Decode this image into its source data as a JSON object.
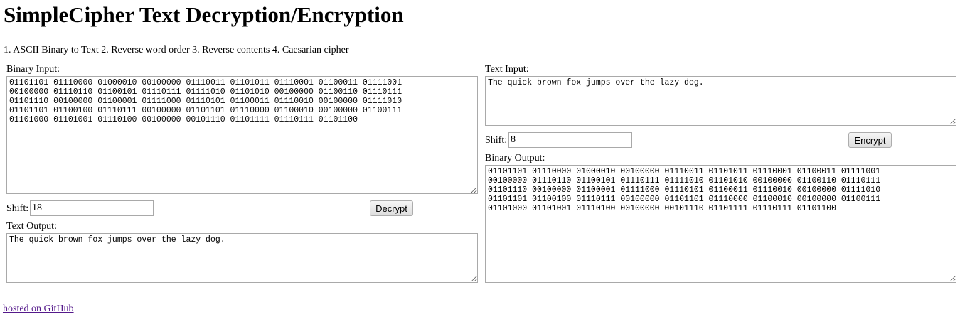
{
  "page": {
    "title": "SimpleCipher Text Decryption/Encryption",
    "steps": "1. ASCII Binary to Text 2. Reverse word order 3. Reverse contents 4. Caesarian cipher",
    "footer_link": "hosted on GitHub"
  },
  "decrypt": {
    "binary_input_label": "Binary Input:",
    "binary_input_value": "01101101 01110000 01000010 00100000 01110011 01101011 01110001 01100011 01111001\n00100000 01110110 01100101 01110111 01111010 01101010 00100000 01100110 01110111\n01101110 00100000 01100001 01111000 01110101 01100011 01110010 00100000 01111010\n01101101 01100100 01110111 00100000 01101101 01110000 01100010 00100000 01100111\n01101000 01101001 01110100 00100000 00101110 01101111 01110111 01101100",
    "shift_label": "Shift:",
    "shift_value": "18",
    "button_label": "Decrypt",
    "text_output_label": "Text Output:",
    "text_output_value": "The quick brown fox jumps over the lazy dog."
  },
  "encrypt": {
    "text_input_label": "Text Input:",
    "text_input_value": "The quick brown fox jumps over the lazy dog.",
    "shift_label": "Shift:",
    "shift_value": "8",
    "button_label": "Encrypt",
    "binary_output_label": "Binary Output:",
    "binary_output_value": "01101101 01110000 01000010 00100000 01110011 01101011 01110001 01100011 01111001\n00100000 01110110 01100101 01110111 01111010 01101010 00100000 01100110 01110111\n01101110 00100000 01100001 01111000 01110101 01100011 01110010 00100000 01111010\n01101101 01100100 01110111 00100000 01101101 01110000 01100010 00100000 01100111\n01101000 01101001 01110100 00100000 00101110 01101111 01110111 01101100"
  }
}
